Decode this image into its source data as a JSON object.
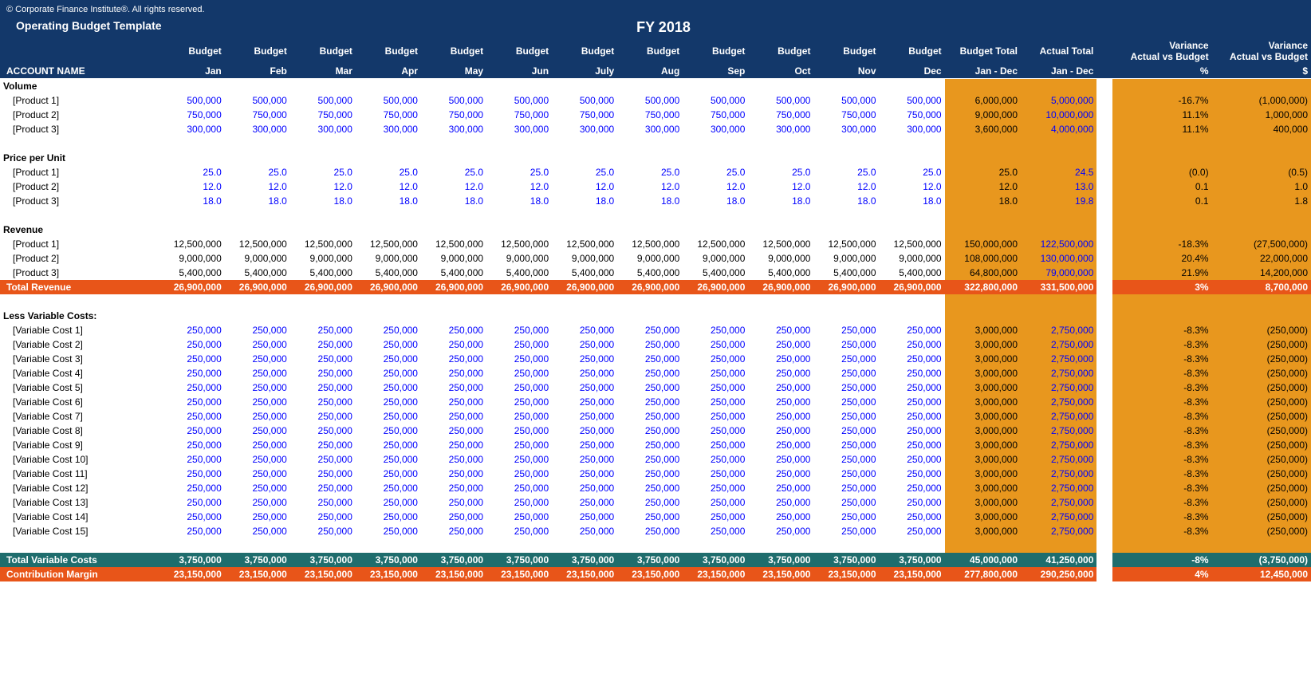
{
  "copyright": "© Corporate Finance Institute®. All rights reserved.",
  "title": "Operating Budget Template",
  "fy": "FY 2018",
  "head": {
    "budget": "Budget",
    "bt": "Budget Total",
    "at": "Actual Total",
    "jd": "Jan - Dec",
    "vab": "Variance",
    "avb": "Actual vs Budget",
    "pct": "%",
    "dol": "$",
    "acct": "ACCOUNT NAME",
    "months": [
      "Jan",
      "Feb",
      "Mar",
      "Apr",
      "May",
      "Jun",
      "July",
      "Aug",
      "Sep",
      "Oct",
      "Nov",
      "Dec"
    ]
  },
  "sections": {
    "volume": {
      "label": "Volume",
      "rows": [
        {
          "name": "[Product 1]",
          "m": "500,000",
          "bt": "6,000,000",
          "at": "5,000,000",
          "vp": "-16.7%",
          "vd": "(1,000,000)"
        },
        {
          "name": "[Product 2]",
          "m": "750,000",
          "bt": "9,000,000",
          "at": "10,000,000",
          "vp": "11.1%",
          "vd": "1,000,000"
        },
        {
          "name": "[Product 3]",
          "m": "300,000",
          "bt": "3,600,000",
          "at": "4,000,000",
          "vp": "11.1%",
          "vd": "400,000"
        }
      ]
    },
    "ppu": {
      "label": "Price per Unit",
      "rows": [
        {
          "name": "[Product 1]",
          "m": "25.0",
          "bt": "25.0",
          "at": "24.5",
          "vp": "(0.0)",
          "vd": "(0.5)"
        },
        {
          "name": "[Product 2]",
          "m": "12.0",
          "bt": "12.0",
          "at": "13.0",
          "vp": "0.1",
          "vd": "1.0"
        },
        {
          "name": "[Product 3]",
          "m": "18.0",
          "bt": "18.0",
          "at": "19.8",
          "vp": "0.1",
          "vd": "1.8"
        }
      ]
    },
    "rev": {
      "label": "Revenue",
      "rows": [
        {
          "name": "[Product 1]",
          "m": "12,500,000",
          "bt": "150,000,000",
          "at": "122,500,000",
          "vp": "-18.3%",
          "vd": "(27,500,000)"
        },
        {
          "name": "[Product 2]",
          "m": "9,000,000",
          "bt": "108,000,000",
          "at": "130,000,000",
          "vp": "20.4%",
          "vd": "22,000,000"
        },
        {
          "name": "[Product 3]",
          "m": "5,400,000",
          "bt": "64,800,000",
          "at": "79,000,000",
          "vp": "21.9%",
          "vd": "14,200,000"
        }
      ]
    },
    "totrev": {
      "label": "Total Revenue",
      "m": "26,900,000",
      "bt": "322,800,000",
      "at": "331,500,000",
      "vp": "3%",
      "vd": "8,700,000"
    },
    "lvc": {
      "label": "Less Variable Costs:",
      "rows": [
        {
          "name": "[Variable Cost 1]",
          "m": "250,000",
          "bt": "3,000,000",
          "at": "2,750,000",
          "vp": "-8.3%",
          "vd": "(250,000)"
        },
        {
          "name": "[Variable Cost 2]",
          "m": "250,000",
          "bt": "3,000,000",
          "at": "2,750,000",
          "vp": "-8.3%",
          "vd": "(250,000)"
        },
        {
          "name": "[Variable Cost 3]",
          "m": "250,000",
          "bt": "3,000,000",
          "at": "2,750,000",
          "vp": "-8.3%",
          "vd": "(250,000)"
        },
        {
          "name": "[Variable Cost 4]",
          "m": "250,000",
          "bt": "3,000,000",
          "at": "2,750,000",
          "vp": "-8.3%",
          "vd": "(250,000)"
        },
        {
          "name": "[Variable Cost 5]",
          "m": "250,000",
          "bt": "3,000,000",
          "at": "2,750,000",
          "vp": "-8.3%",
          "vd": "(250,000)"
        },
        {
          "name": "[Variable Cost 6]",
          "m": "250,000",
          "bt": "3,000,000",
          "at": "2,750,000",
          "vp": "-8.3%",
          "vd": "(250,000)"
        },
        {
          "name": "[Variable Cost 7]",
          "m": "250,000",
          "bt": "3,000,000",
          "at": "2,750,000",
          "vp": "-8.3%",
          "vd": "(250,000)"
        },
        {
          "name": "[Variable Cost 8]",
          "m": "250,000",
          "bt": "3,000,000",
          "at": "2,750,000",
          "vp": "-8.3%",
          "vd": "(250,000)"
        },
        {
          "name": "[Variable Cost 9]",
          "m": "250,000",
          "bt": "3,000,000",
          "at": "2,750,000",
          "vp": "-8.3%",
          "vd": "(250,000)"
        },
        {
          "name": "[Variable Cost 10]",
          "m": "250,000",
          "bt": "3,000,000",
          "at": "2,750,000",
          "vp": "-8.3%",
          "vd": "(250,000)"
        },
        {
          "name": "[Variable Cost 11]",
          "m": "250,000",
          "bt": "3,000,000",
          "at": "2,750,000",
          "vp": "-8.3%",
          "vd": "(250,000)"
        },
        {
          "name": "[Variable Cost 12]",
          "m": "250,000",
          "bt": "3,000,000",
          "at": "2,750,000",
          "vp": "-8.3%",
          "vd": "(250,000)"
        },
        {
          "name": "[Variable Cost 13]",
          "m": "250,000",
          "bt": "3,000,000",
          "at": "2,750,000",
          "vp": "-8.3%",
          "vd": "(250,000)"
        },
        {
          "name": "[Variable Cost 14]",
          "m": "250,000",
          "bt": "3,000,000",
          "at": "2,750,000",
          "vp": "-8.3%",
          "vd": "(250,000)"
        },
        {
          "name": "[Variable Cost 15]",
          "m": "250,000",
          "bt": "3,000,000",
          "at": "2,750,000",
          "vp": "-8.3%",
          "vd": "(250,000)"
        }
      ]
    },
    "tvc": {
      "label": "Total Variable Costs",
      "m": "3,750,000",
      "bt": "45,000,000",
      "at": "41,250,000",
      "vp": "-8%",
      "vd": "(3,750,000)"
    },
    "cm": {
      "label": "Contribution Margin",
      "m": "23,150,000",
      "bt": "277,800,000",
      "at": "290,250,000",
      "vp": "4%",
      "vd": "12,450,000"
    }
  }
}
